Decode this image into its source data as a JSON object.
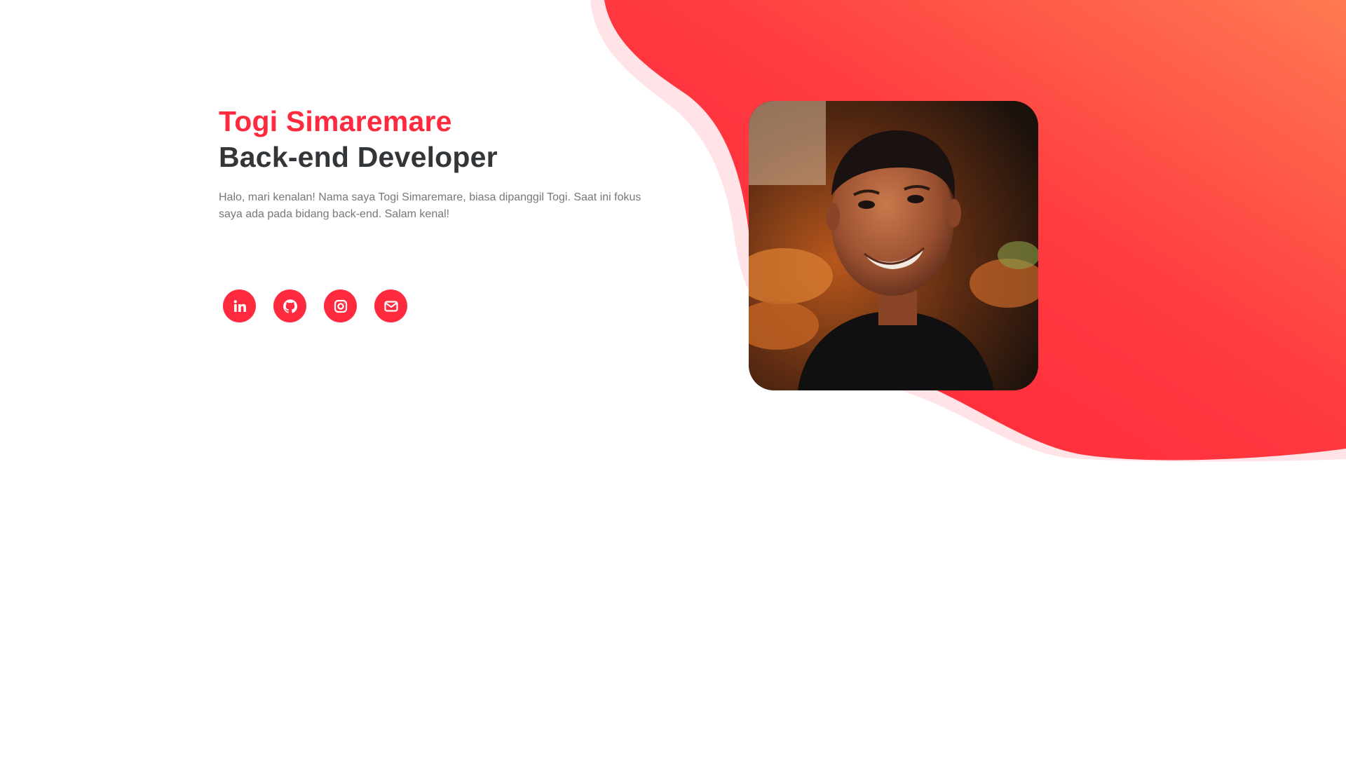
{
  "hero": {
    "name": "Togi Simaremare",
    "role": "Back-end Developer",
    "bio": "Halo, mari kenalan! Nama saya Togi Simaremare, biasa dipanggil Togi. Saat ini fokus saya ada pada bidang back-end. Salam kenal!"
  },
  "socials": [
    {
      "icon": "linkedin-icon",
      "label": "LinkedIn"
    },
    {
      "icon": "github-icon",
      "label": "GitHub"
    },
    {
      "icon": "instagram-icon",
      "label": "Instagram"
    },
    {
      "icon": "mail-icon",
      "label": "Email"
    }
  ],
  "colors": {
    "accent": "#ff2a3e",
    "heading_dark": "#333639",
    "body_text": "#74787c",
    "blob_light": "#ffe3e6",
    "gradient_top": "#ff7a52",
    "gradient_bottom": "#ff2438"
  }
}
